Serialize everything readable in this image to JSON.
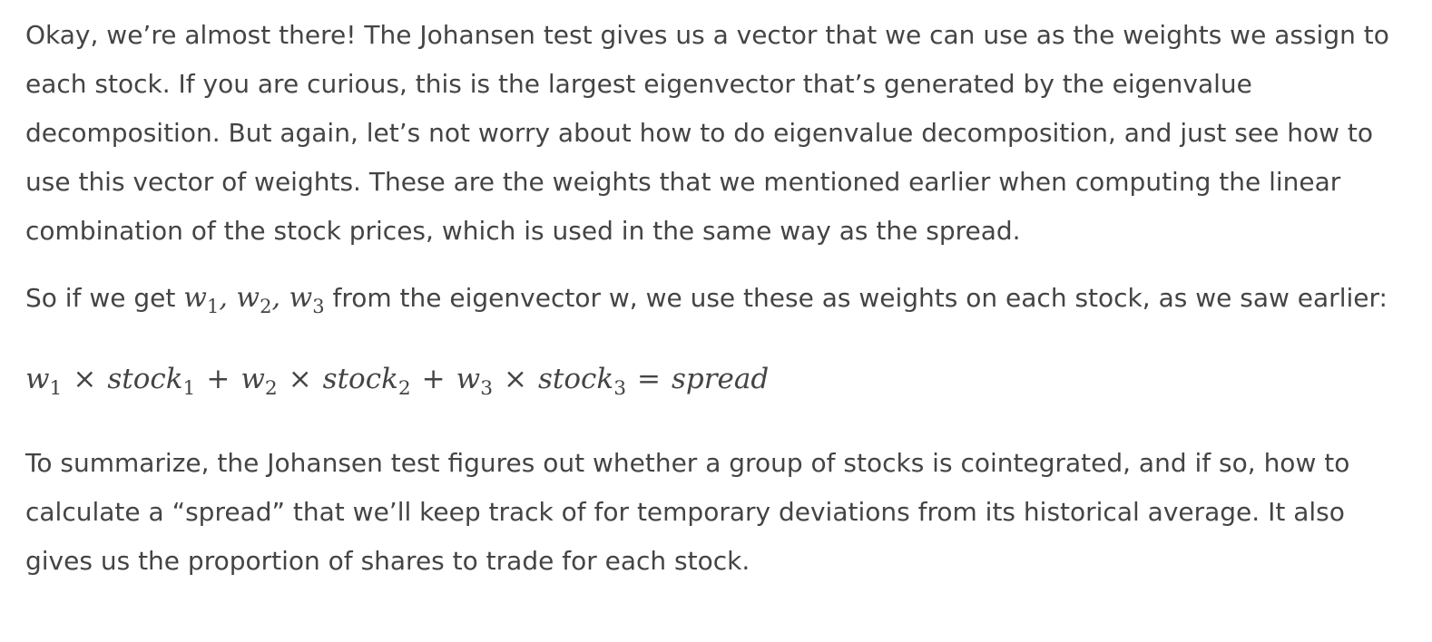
{
  "article": {
    "paragraph1": "Okay, we’re almost there! The Johansen test gives us a vector that we can use as the weights we assign to each stock. If you are curious, this is the largest eigenvector that’s generated by the eigenvalue decomposition. But again, let’s not worry about how to do eigenvalue decomposition, and just see how to use this vector of weights. These are the weights that we mentioned earlier when computing the linear combination of the stock prices, which is used in the same way as the spread.",
    "paragraph2": {
      "before": "So if we get ",
      "w_symbol": "w",
      "sub1": "1",
      "sub2": "2",
      "sub3": "3",
      "comma": ", ",
      "after": " from the eigenvector w, we use these as weights on each stock, as we saw earlier:"
    },
    "equation": {
      "w": "w",
      "stock": "stock",
      "sub1": "1",
      "sub2": "2",
      "sub3": "3",
      "times": "×",
      "plus": "+",
      "equals": "=",
      "result": "spread"
    },
    "paragraph3": "To summarize, the Johansen test figures out whether a group of stocks is cointegrated, and if so, how to calculate a “spread” that we’ll keep track of for temporary deviations from its historical average. It also gives us the proportion of shares to trade for each stock."
  }
}
